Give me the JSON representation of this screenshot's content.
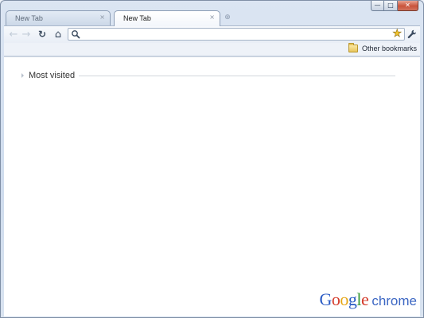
{
  "window": {
    "controls": {
      "minimize": "—",
      "maximize": "□",
      "close": "✕"
    }
  },
  "tabs": [
    {
      "label": "New Tab",
      "active": false
    },
    {
      "label": "New Tab",
      "active": true
    }
  ],
  "tab_close_glyph": "×",
  "new_tab_glyph": "⊕",
  "toolbar": {
    "back_icon": "←",
    "forward_icon": "→",
    "reload_icon": "↻",
    "home_icon": "⌂",
    "omnibox_value": "",
    "star_icon": "★",
    "wrench_icon": "🔧"
  },
  "bookmarks_bar": {
    "other_bookmarks_label": "Other bookmarks"
  },
  "content": {
    "most_visited_label": "Most visited",
    "brand_google_letters": [
      "G",
      "o",
      "o",
      "g",
      "l",
      "e"
    ],
    "brand_chrome": "chrome"
  }
}
